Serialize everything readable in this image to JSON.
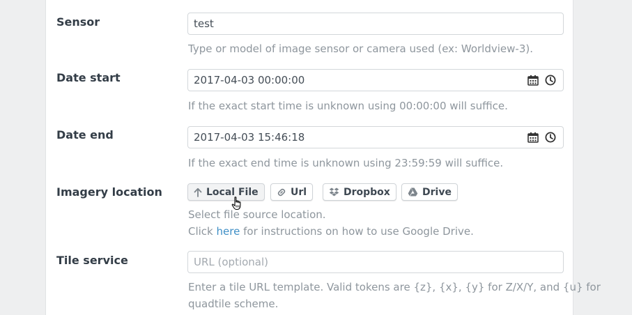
{
  "fields": {
    "sensor": {
      "label": "Sensor",
      "value": "test",
      "help": "Type or model of image sensor or camera used (ex: Worldview-3)."
    },
    "date_start": {
      "label": "Date start",
      "value": "2017-04-03 00:00:00",
      "help": "If the exact start time is unknown using 00:00:00 will suffice."
    },
    "date_end": {
      "label": "Date end",
      "value": "2017-04-03 15:46:18",
      "help": "If the exact end time is unknown using 23:59:59 will suffice."
    },
    "imagery_location": {
      "label": "Imagery location",
      "buttons": [
        {
          "label": "Local File",
          "icon": "arrow-up-icon"
        },
        {
          "label": "Url",
          "icon": "link-icon"
        },
        {
          "label": "Dropbox",
          "icon": "dropbox-icon"
        },
        {
          "label": "Drive",
          "icon": "drive-icon"
        }
      ],
      "help_line1": "Select file source location.",
      "help_prefix": "Click",
      "help_link": "here",
      "help_suffix": "for instructions on how to use Google Drive."
    },
    "tile_service": {
      "label": "Tile service",
      "placeholder": "URL (optional)",
      "help_line1": "Enter a tile URL template. Valid tokens are {z}, {x}, {y} for Z/X/Y, and {u} for",
      "help_line2": "quadtile scheme."
    }
  },
  "colors": {
    "page_background": "#eeeff0",
    "label": "#333d47",
    "help_text": "#8e969d",
    "link": "#3f8fc6"
  }
}
